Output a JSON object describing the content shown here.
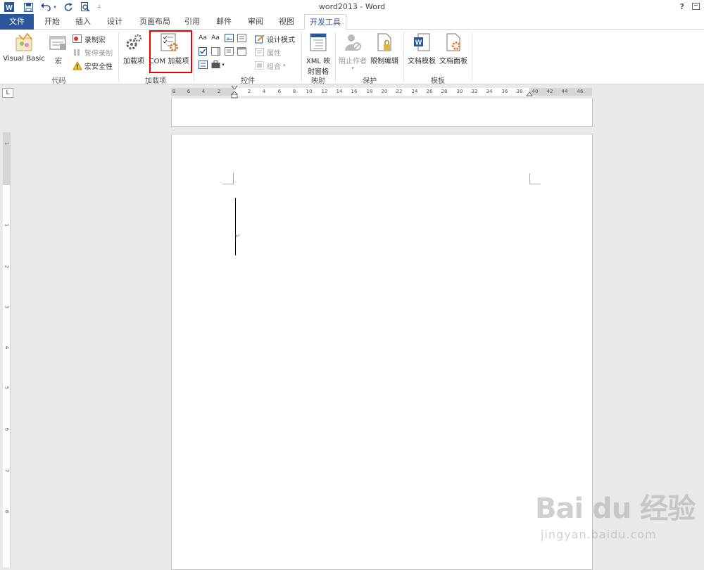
{
  "window": {
    "title": "word2013 - Word",
    "help": "?"
  },
  "tabs": [
    {
      "label": "文件"
    },
    {
      "label": "开始"
    },
    {
      "label": "插入"
    },
    {
      "label": "设计"
    },
    {
      "label": "页面布局"
    },
    {
      "label": "引用"
    },
    {
      "label": "邮件"
    },
    {
      "label": "审阅"
    },
    {
      "label": "视图"
    },
    {
      "label": "开发工具"
    }
  ],
  "ribbon": {
    "code": {
      "label": "代码",
      "visual_basic": "Visual Basic",
      "macros": "宏",
      "record_macro": "录制宏",
      "pause_recording": "暂停录制",
      "macro_security": "宏安全性"
    },
    "addins": {
      "label": "加载项",
      "addins_btn": "加载项",
      "com_addins": "COM 加载项"
    },
    "controls": {
      "label": "控件",
      "design_mode": "设计模式",
      "properties": "属性",
      "group": "组合"
    },
    "mapping": {
      "label": "映射",
      "xml_line1": "XML 映",
      "xml_line2": "射窗格"
    },
    "protect": {
      "label": "保护",
      "block_authors": "阻止作者",
      "restrict_editing": "限制编辑"
    },
    "templates": {
      "label": "模板",
      "document_template": "文档模板",
      "document_panel": "文档面板"
    }
  },
  "ruler": {
    "corner": "L",
    "left_ticks": [
      "8",
      "6",
      "4",
      "2"
    ],
    "right_ticks": [
      "2",
      "4",
      "6",
      "8",
      "10",
      "12",
      "14",
      "16",
      "18",
      "20",
      "22",
      "24",
      "26",
      "28",
      "30",
      "32",
      "34",
      "36",
      "38",
      "40",
      "42",
      "44",
      "46"
    ],
    "vertical_ticks": [
      "1",
      "1",
      "2",
      "3",
      "4",
      "5",
      "6",
      "7",
      "8"
    ]
  },
  "watermark": {
    "logo": "Bai du 经验",
    "url": "jingyan.baidu.com"
  },
  "colors": {
    "file_tab": "#2b579a",
    "active_tab_text": "#2b579a",
    "highlight": "#ee0000"
  }
}
